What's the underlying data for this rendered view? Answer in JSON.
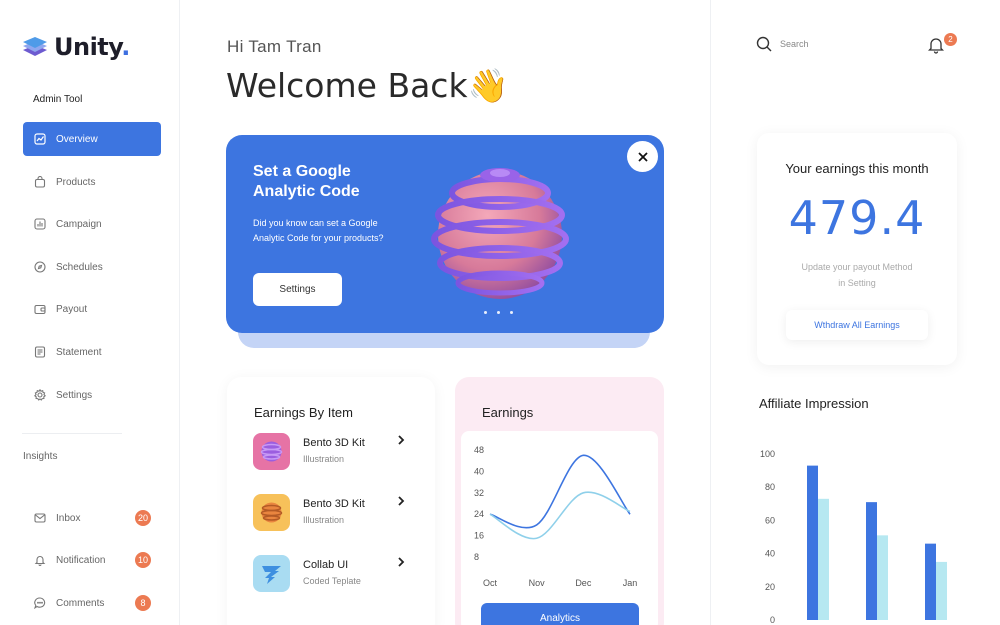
{
  "brand": {
    "name": "Unity",
    "dot": "."
  },
  "sidebar": {
    "section_label": "Admin Tool",
    "items": [
      {
        "label": "Overview",
        "icon": "chart-icon",
        "active": true
      },
      {
        "label": "Products",
        "icon": "bag-icon"
      },
      {
        "label": "Campaign",
        "icon": "bar-chart-icon"
      },
      {
        "label": "Schedules",
        "icon": "compass-icon"
      },
      {
        "label": "Payout",
        "icon": "wallet-icon"
      },
      {
        "label": "Statement",
        "icon": "document-icon"
      },
      {
        "label": "Settings",
        "icon": "gear-icon"
      }
    ],
    "insights_label": "Insights",
    "insight_items": [
      {
        "label": "Inbox",
        "icon": "mail-icon",
        "count": "20"
      },
      {
        "label": "Notification",
        "icon": "bell-icon",
        "count": "10"
      },
      {
        "label": "Comments",
        "icon": "comment-icon",
        "count": "8"
      }
    ]
  },
  "header": {
    "greeting": "Hi Tam Tran",
    "title": "Welcome Back",
    "wave": "👋"
  },
  "promo": {
    "title": "Set a Google Analytic Code",
    "text": "Did you know can set a Google Analytic Code for your products?",
    "button": "Settings"
  },
  "earnings_by_item": {
    "title": "Earnings By Item",
    "items": [
      {
        "title": "Bento 3D Kit",
        "subtitle": "Illustration"
      },
      {
        "title": "Bento 3D Kit",
        "subtitle": "Illustration"
      },
      {
        "title": "Collab UI",
        "subtitle": "Coded Teplate"
      }
    ]
  },
  "earnings_chart": {
    "title": "Earnings",
    "button": "Analytics"
  },
  "search": {
    "placeholder": "Search"
  },
  "notifications": {
    "count": "2"
  },
  "earnings_month": {
    "title": "Your earnings this month",
    "value": "479.4",
    "note": "Update your payout Method in Setting",
    "button": "Wthdraw All Earnings"
  },
  "colors": {
    "primary": "#3d75e0",
    "light": "#b6e8f1",
    "badge": "#ec7a52"
  },
  "chart_data": [
    {
      "type": "line",
      "title": "Earnings",
      "x": [
        "Oct",
        "Nov",
        "Dec",
        "Jan"
      ],
      "yticks": [
        8,
        16,
        24,
        32,
        40,
        48
      ],
      "ylim": [
        8,
        48
      ],
      "series": [
        {
          "values": [
            24,
            20,
            46,
            24
          ],
          "color": "#3d75e0"
        },
        {
          "values": [
            24,
            15,
            32,
            25
          ],
          "color": "#8fd0ea"
        }
      ]
    },
    {
      "type": "bar",
      "title": "Affiliate Impression",
      "yticks": [
        0,
        20,
        40,
        60,
        80,
        100
      ],
      "ylim": [
        0,
        100
      ],
      "categories": [
        "",
        "",
        ""
      ],
      "series": [
        {
          "values": [
            93,
            71,
            46
          ],
          "color": "#3d75e0"
        },
        {
          "values": [
            73,
            51,
            35
          ],
          "color": "#b6e8f1"
        }
      ]
    }
  ]
}
